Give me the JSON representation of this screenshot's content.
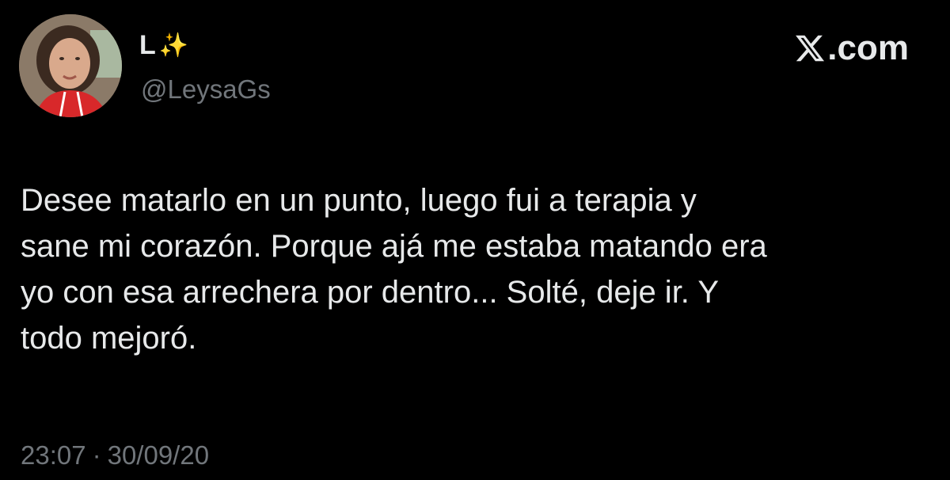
{
  "author": {
    "display_name": "L",
    "name_emoji": "✨",
    "handle": "@LeysaGs"
  },
  "brand": {
    "logo_icon": "x-logo-icon",
    "label": ".com"
  },
  "tweet": {
    "text": "Desee matarlo en un punto, luego fui a terapia y\nsane mi corazón. Porque ajá me estaba matando era\nyo con esa arrechera por dentro... Solté, deje ir. Y\ntodo mejoró."
  },
  "meta": {
    "time": "23:07",
    "separator": "·",
    "date": "30/09/20"
  },
  "colors": {
    "background": "#000000",
    "text": "#e7e9ea",
    "secondary": "#71767b",
    "sparkle": "#f7c948"
  }
}
